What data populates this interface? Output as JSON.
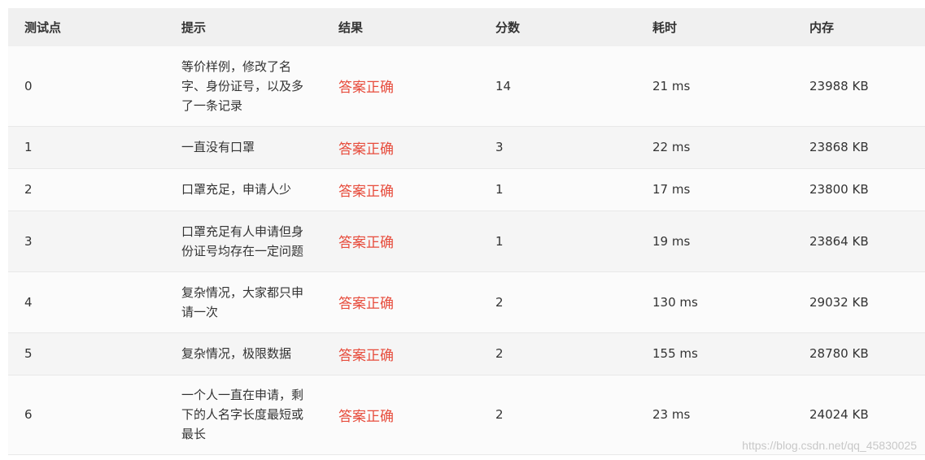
{
  "table": {
    "headers": [
      "测试点",
      "提示",
      "结果",
      "分数",
      "耗时",
      "内存"
    ],
    "rows": [
      {
        "id": "0",
        "hint": "等价样例，修改了名字、身份证号，以及多了一条记录",
        "result": "答案正确",
        "score": "14",
        "time": "21 ms",
        "memory": "23988 KB"
      },
      {
        "id": "1",
        "hint": "一直没有口罩",
        "result": "答案正确",
        "score": "3",
        "time": "22 ms",
        "memory": "23868 KB"
      },
      {
        "id": "2",
        "hint": "口罩充足，申请人少",
        "result": "答案正确",
        "score": "1",
        "time": "17 ms",
        "memory": "23800 KB"
      },
      {
        "id": "3",
        "hint": "口罩充足有人申请但身份证号均存在一定问题",
        "result": "答案正确",
        "score": "1",
        "time": "19 ms",
        "memory": "23864 KB"
      },
      {
        "id": "4",
        "hint": "复杂情况，大家都只申请一次",
        "result": "答案正确",
        "score": "2",
        "time": "130 ms",
        "memory": "29032 KB"
      },
      {
        "id": "5",
        "hint": "复杂情况，极限数据",
        "result": "答案正确",
        "score": "2",
        "time": "155 ms",
        "memory": "28780 KB"
      },
      {
        "id": "6",
        "hint": "一个人一直在申请，剩下的人名字长度最短或最长",
        "result": "答案正确",
        "score": "2",
        "time": "23 ms",
        "memory": "24024 KB"
      }
    ]
  },
  "watermark": "https://blog.csdn.net/qq_45830025",
  "colors": {
    "accepted": "#e74c3c",
    "header_bg": "#f0f0f0"
  }
}
